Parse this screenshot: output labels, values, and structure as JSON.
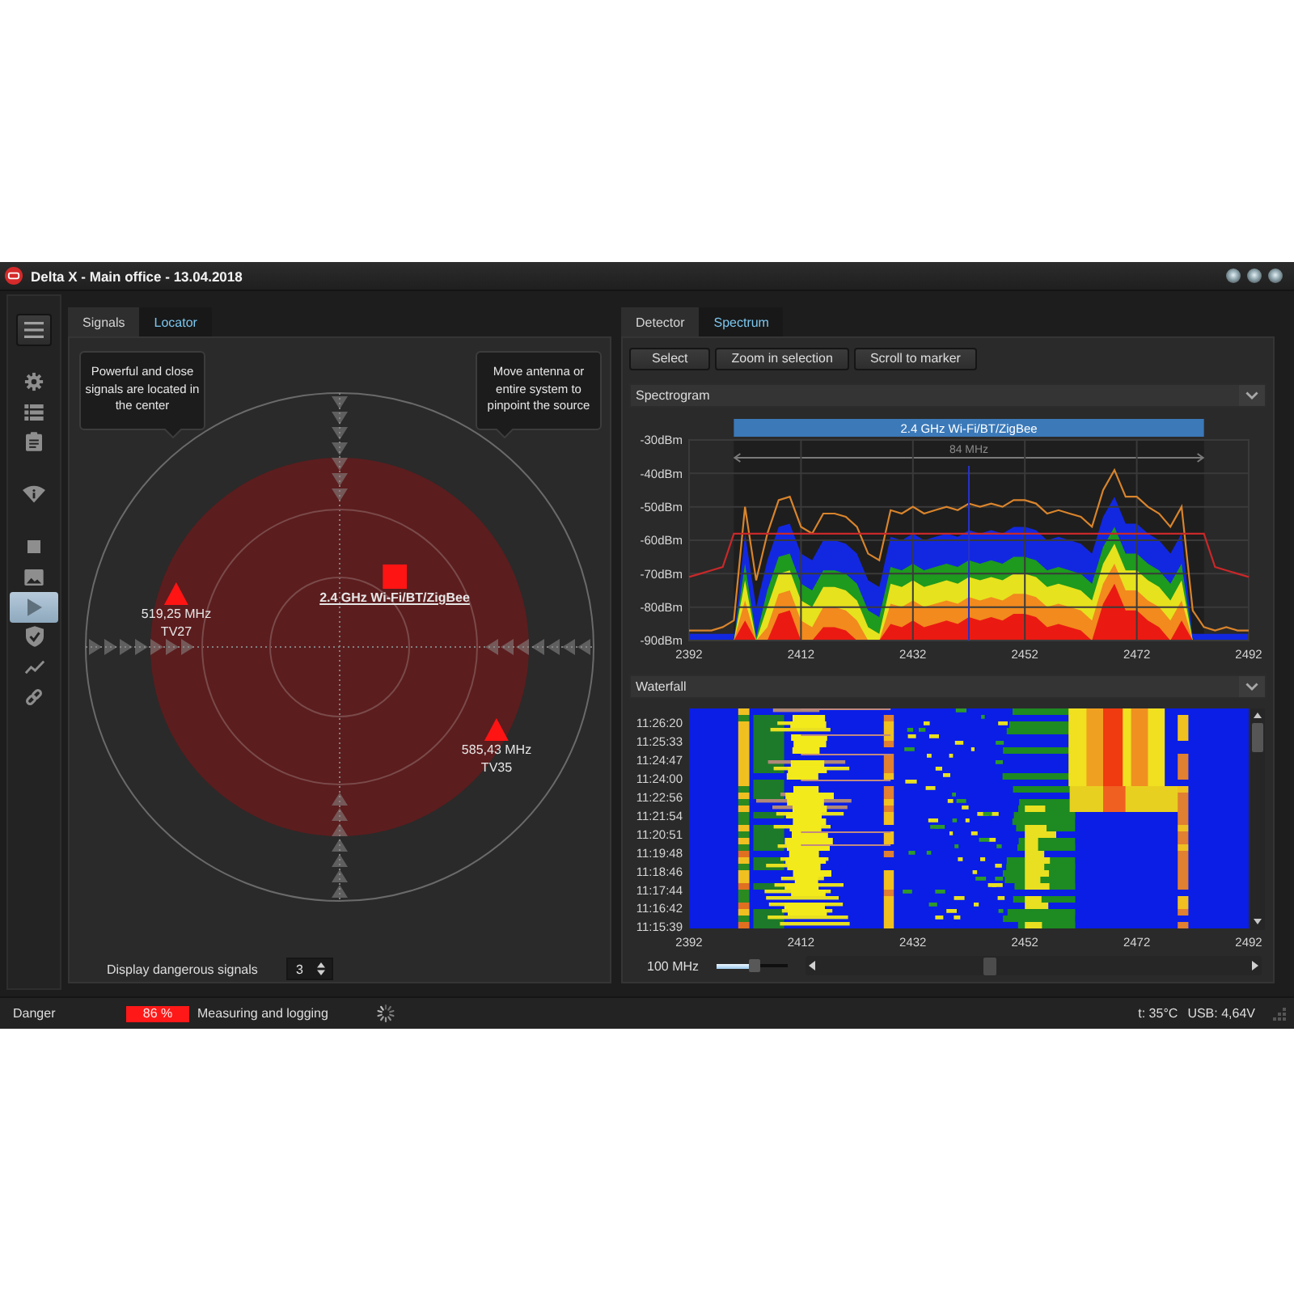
{
  "window": {
    "title": "Delta X - Main office - 13.04.2018"
  },
  "sidebar": {
    "sections": [
      {
        "items": [
          {
            "selected": false
          },
          {
            "selected": false
          },
          {
            "selected": false
          }
        ]
      },
      {
        "items": [
          {
            "selected": false
          }
        ]
      },
      {
        "items": [
          {
            "selected": false
          },
          {
            "selected": false
          },
          {
            "selected": true
          },
          {
            "selected": false
          },
          {
            "selected": false
          },
          {
            "selected": false
          }
        ]
      }
    ]
  },
  "locator": {
    "tabs": [
      {
        "label": "Signals",
        "selected": false
      },
      {
        "label": "Locator",
        "selected": true
      }
    ],
    "hints": [
      "Powerful and close signals are located in the center",
      "Move antenna or entire system to pinpoint the source"
    ],
    "signals": [
      {
        "kind": "square",
        "lines": [
          "2.4 GHz Wi-Fi/BT/ZigBee"
        ],
        "selected": true
      },
      {
        "kind": "triangle",
        "lines": [
          "519,25 MHz",
          "TV27"
        ],
        "selected": false
      },
      {
        "kind": "triangle",
        "lines": [
          "585,43 MHz",
          "TV35"
        ],
        "selected": false
      }
    ],
    "dangerous_signals": {
      "label": "Display dangerous signals",
      "value": "3"
    }
  },
  "spectrum": {
    "tabs": [
      {
        "label": "Detector",
        "selected": false
      },
      {
        "label": "Spectrum",
        "selected": true
      }
    ],
    "buttons": [
      "Select",
      "Zoom in selection",
      "Scroll to marker"
    ],
    "spectrogram": {
      "title": "Spectrogram",
      "expanded": true,
      "band_width": "84 MHz",
      "chart_data": {
        "type": "line",
        "x": [
          2392,
          2394,
          2396,
          2398,
          2400,
          2402,
          2404,
          2406,
          2408,
          2410,
          2412,
          2414,
          2416,
          2418,
          2420,
          2422,
          2424,
          2426,
          2428,
          2430,
          2432,
          2434,
          2436,
          2438,
          2440,
          2442,
          2444,
          2446,
          2448,
          2450,
          2452,
          2454,
          2456,
          2458,
          2460,
          2462,
          2464,
          2466,
          2468,
          2470,
          2472,
          2474,
          2476,
          2478,
          2480,
          2482,
          2484,
          2486,
          2488,
          2490,
          2492
        ],
        "series": [
          {
            "color": "#d9842c",
            "values": [
              -87,
              -87,
              -87,
              -86,
              -84,
              -50,
              -72,
              -58,
              -48,
              -47,
              -56,
              -58,
              -52,
              -52,
              -53,
              -56,
              -64,
              -66,
              -51,
              -52,
              -50,
              -52,
              -51,
              -50,
              -51,
              -49,
              -50,
              -49,
              -50,
              -48,
              -48,
              -49,
              -52,
              -51,
              -52,
              -53,
              -56,
              -45,
              -39,
              -47,
              -47,
              -50,
              -52,
              -56,
              -50,
              -81,
              -86,
              -87,
              -86,
              -87,
              -87
            ]
          },
          {
            "color": "#c8282a",
            "values": [
              -71,
              -70,
              -69,
              -68,
              -58,
              -58,
              -58,
              -58,
              -58,
              -58,
              -58,
              -58,
              -58,
              -58,
              -58,
              -58,
              -58,
              -58,
              -58,
              -58,
              -58,
              -58,
              -58,
              -58,
              -58,
              -58,
              -58,
              -58,
              -58,
              -58,
              -58,
              -58,
              -58,
              -58,
              -58,
              -58,
              -58,
              -58,
              -58,
              -58,
              -58,
              -58,
              -58,
              -58,
              -58,
              -58,
              -58,
              -68,
              -69,
              -70,
              -71
            ]
          }
        ],
        "xlim": [
          2392,
          2492
        ],
        "ylim": [
          -90,
          -30
        ],
        "xticks": [
          2392,
          2412,
          2432,
          2452,
          2472,
          2492
        ],
        "yticks": [
          {
            "value": -30,
            "label": "-30dBm"
          },
          {
            "value": -40,
            "label": "-40dBm"
          },
          {
            "value": -50,
            "label": "-50dBm"
          },
          {
            "value": -60,
            "label": "-60dBm"
          },
          {
            "value": -70,
            "label": "-70dBm"
          },
          {
            "value": -80,
            "label": "-80dBm"
          },
          {
            "value": -90,
            "label": "-90dBm"
          }
        ],
        "grid": true,
        "bands": [
          {
            "axis": "x",
            "from": 2400,
            "to": 2484,
            "label": "2.4 GHz Wi-Fi/BT/ZigBee"
          }
        ],
        "ref_lines": [
          {
            "axis": "x",
            "value": 2442
          }
        ]
      }
    },
    "waterfall": {
      "title": "Waterfall",
      "expanded": true,
      "times": [
        "11:26:20",
        "11:25:33",
        "11:24:47",
        "11:24:00",
        "11:22:56",
        "11:21:54",
        "11:20:51",
        "11:19:48",
        "11:18:46",
        "11:17:44",
        "11:16:42",
        "11:15:39"
      ],
      "xticks": [
        "2392",
        "2412",
        "2432",
        "2452",
        "2472",
        "2492"
      ]
    },
    "span": {
      "label": "100 MHz",
      "level": 0.55
    }
  },
  "status_bar": {
    "state": "Danger",
    "danger": "86 %",
    "activity": "Measuring and logging",
    "temperature": "t: 35°C",
    "usb": "USB: 4,64V"
  }
}
